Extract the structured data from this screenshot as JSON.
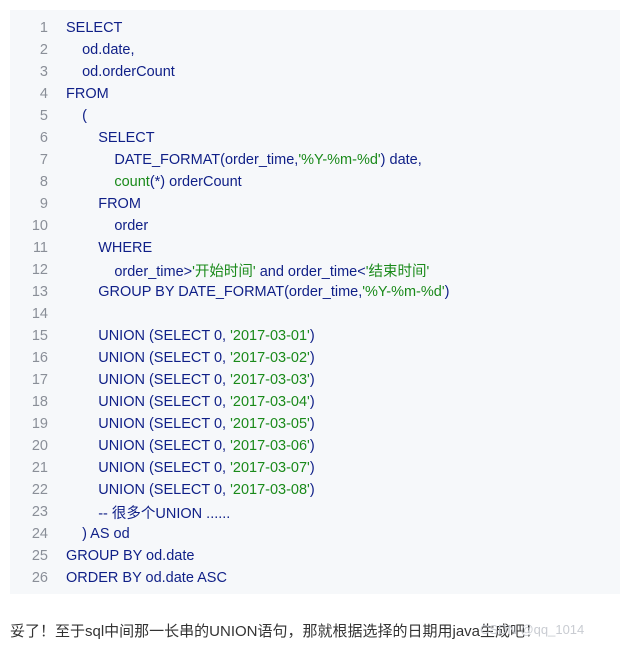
{
  "code": {
    "lines": [
      {
        "n": "1",
        "t": [
          {
            "s": "SELECT",
            "c": "kw"
          }
        ]
      },
      {
        "n": "2",
        "t": [
          {
            "s": "    od.date,",
            "c": "pl"
          }
        ]
      },
      {
        "n": "3",
        "t": [
          {
            "s": "    od.orderCount",
            "c": "pl"
          }
        ]
      },
      {
        "n": "4",
        "t": [
          {
            "s": "FROM",
            "c": "kw"
          }
        ]
      },
      {
        "n": "5",
        "t": [
          {
            "s": "    (",
            "c": "pl"
          }
        ]
      },
      {
        "n": "6",
        "t": [
          {
            "s": "        SELECT",
            "c": "kw"
          }
        ]
      },
      {
        "n": "7",
        "t": [
          {
            "s": "            DATE_FORMAT(order_time,",
            "c": "pl"
          },
          {
            "s": "'%Y-%m-%d'",
            "c": "str"
          },
          {
            "s": ") date,",
            "c": "pl"
          }
        ]
      },
      {
        "n": "8",
        "t": [
          {
            "s": "            ",
            "c": "pl"
          },
          {
            "s": "count",
            "c": "fn"
          },
          {
            "s": "(*) orderCount",
            "c": "pl"
          }
        ]
      },
      {
        "n": "9",
        "t": [
          {
            "s": "        FROM",
            "c": "kw"
          }
        ]
      },
      {
        "n": "10",
        "t": [
          {
            "s": "            order",
            "c": "pl"
          }
        ]
      },
      {
        "n": "11",
        "t": [
          {
            "s": "        WHERE",
            "c": "kw"
          }
        ]
      },
      {
        "n": "12",
        "t": [
          {
            "s": "            order_time>",
            "c": "pl"
          },
          {
            "s": "'开始时间'",
            "c": "str"
          },
          {
            "s": " and order_time<",
            "c": "pl"
          },
          {
            "s": "'结束时间'",
            "c": "str"
          }
        ]
      },
      {
        "n": "13",
        "t": [
          {
            "s": "        GROUP BY DATE_FORMAT(order_time,",
            "c": "pl"
          },
          {
            "s": "'%Y-%m-%d'",
            "c": "str"
          },
          {
            "s": ")",
            "c": "pl"
          }
        ]
      },
      {
        "n": "14",
        "t": [
          {
            "s": "",
            "c": "pl"
          }
        ]
      },
      {
        "n": "15",
        "t": [
          {
            "s": "        UNION (SELECT 0, ",
            "c": "pl"
          },
          {
            "s": "'2017-03-01'",
            "c": "str"
          },
          {
            "s": ")",
            "c": "pl"
          }
        ]
      },
      {
        "n": "16",
        "t": [
          {
            "s": "        UNION (SELECT 0, ",
            "c": "pl"
          },
          {
            "s": "'2017-03-02'",
            "c": "str"
          },
          {
            "s": ")",
            "c": "pl"
          }
        ]
      },
      {
        "n": "17",
        "t": [
          {
            "s": "        UNION (SELECT 0, ",
            "c": "pl"
          },
          {
            "s": "'2017-03-03'",
            "c": "str"
          },
          {
            "s": ")",
            "c": "pl"
          }
        ]
      },
      {
        "n": "18",
        "t": [
          {
            "s": "        UNION (SELECT 0, ",
            "c": "pl"
          },
          {
            "s": "'2017-03-04'",
            "c": "str"
          },
          {
            "s": ")",
            "c": "pl"
          }
        ]
      },
      {
        "n": "19",
        "t": [
          {
            "s": "        UNION (SELECT 0, ",
            "c": "pl"
          },
          {
            "s": "'2017-03-05'",
            "c": "str"
          },
          {
            "s": ")",
            "c": "pl"
          }
        ]
      },
      {
        "n": "20",
        "t": [
          {
            "s": "        UNION (SELECT 0, ",
            "c": "pl"
          },
          {
            "s": "'2017-03-06'",
            "c": "str"
          },
          {
            "s": ")",
            "c": "pl"
          }
        ]
      },
      {
        "n": "21",
        "t": [
          {
            "s": "        UNION (SELECT 0, ",
            "c": "pl"
          },
          {
            "s": "'2017-03-07'",
            "c": "str"
          },
          {
            "s": ")",
            "c": "pl"
          }
        ]
      },
      {
        "n": "22",
        "t": [
          {
            "s": "        UNION (SELECT 0, ",
            "c": "pl"
          },
          {
            "s": "'2017-03-08'",
            "c": "str"
          },
          {
            "s": ")",
            "c": "pl"
          }
        ]
      },
      {
        "n": "23",
        "t": [
          {
            "s": "        -- 很多个UNION ......",
            "c": "pl"
          }
        ]
      },
      {
        "n": "24",
        "t": [
          {
            "s": "    ) AS od",
            "c": "pl"
          }
        ]
      },
      {
        "n": "25",
        "t": [
          {
            "s": "GROUP BY od.date",
            "c": "pl"
          }
        ]
      },
      {
        "n": "26",
        "t": [
          {
            "s": "ORDER BY od.date ASC",
            "c": "pl"
          }
        ]
      }
    ]
  },
  "caption": "妥了！至于sql中间那一长串的UNION语句，那就根据选择的日期用java生成吧！",
  "watermark": "CSDN @qq_1014",
  "colors": {
    "code_bg": "#f6f8fa",
    "keyword": "#0f1f87",
    "string": "#1a8a1a",
    "line_number": "#8a8f98"
  }
}
